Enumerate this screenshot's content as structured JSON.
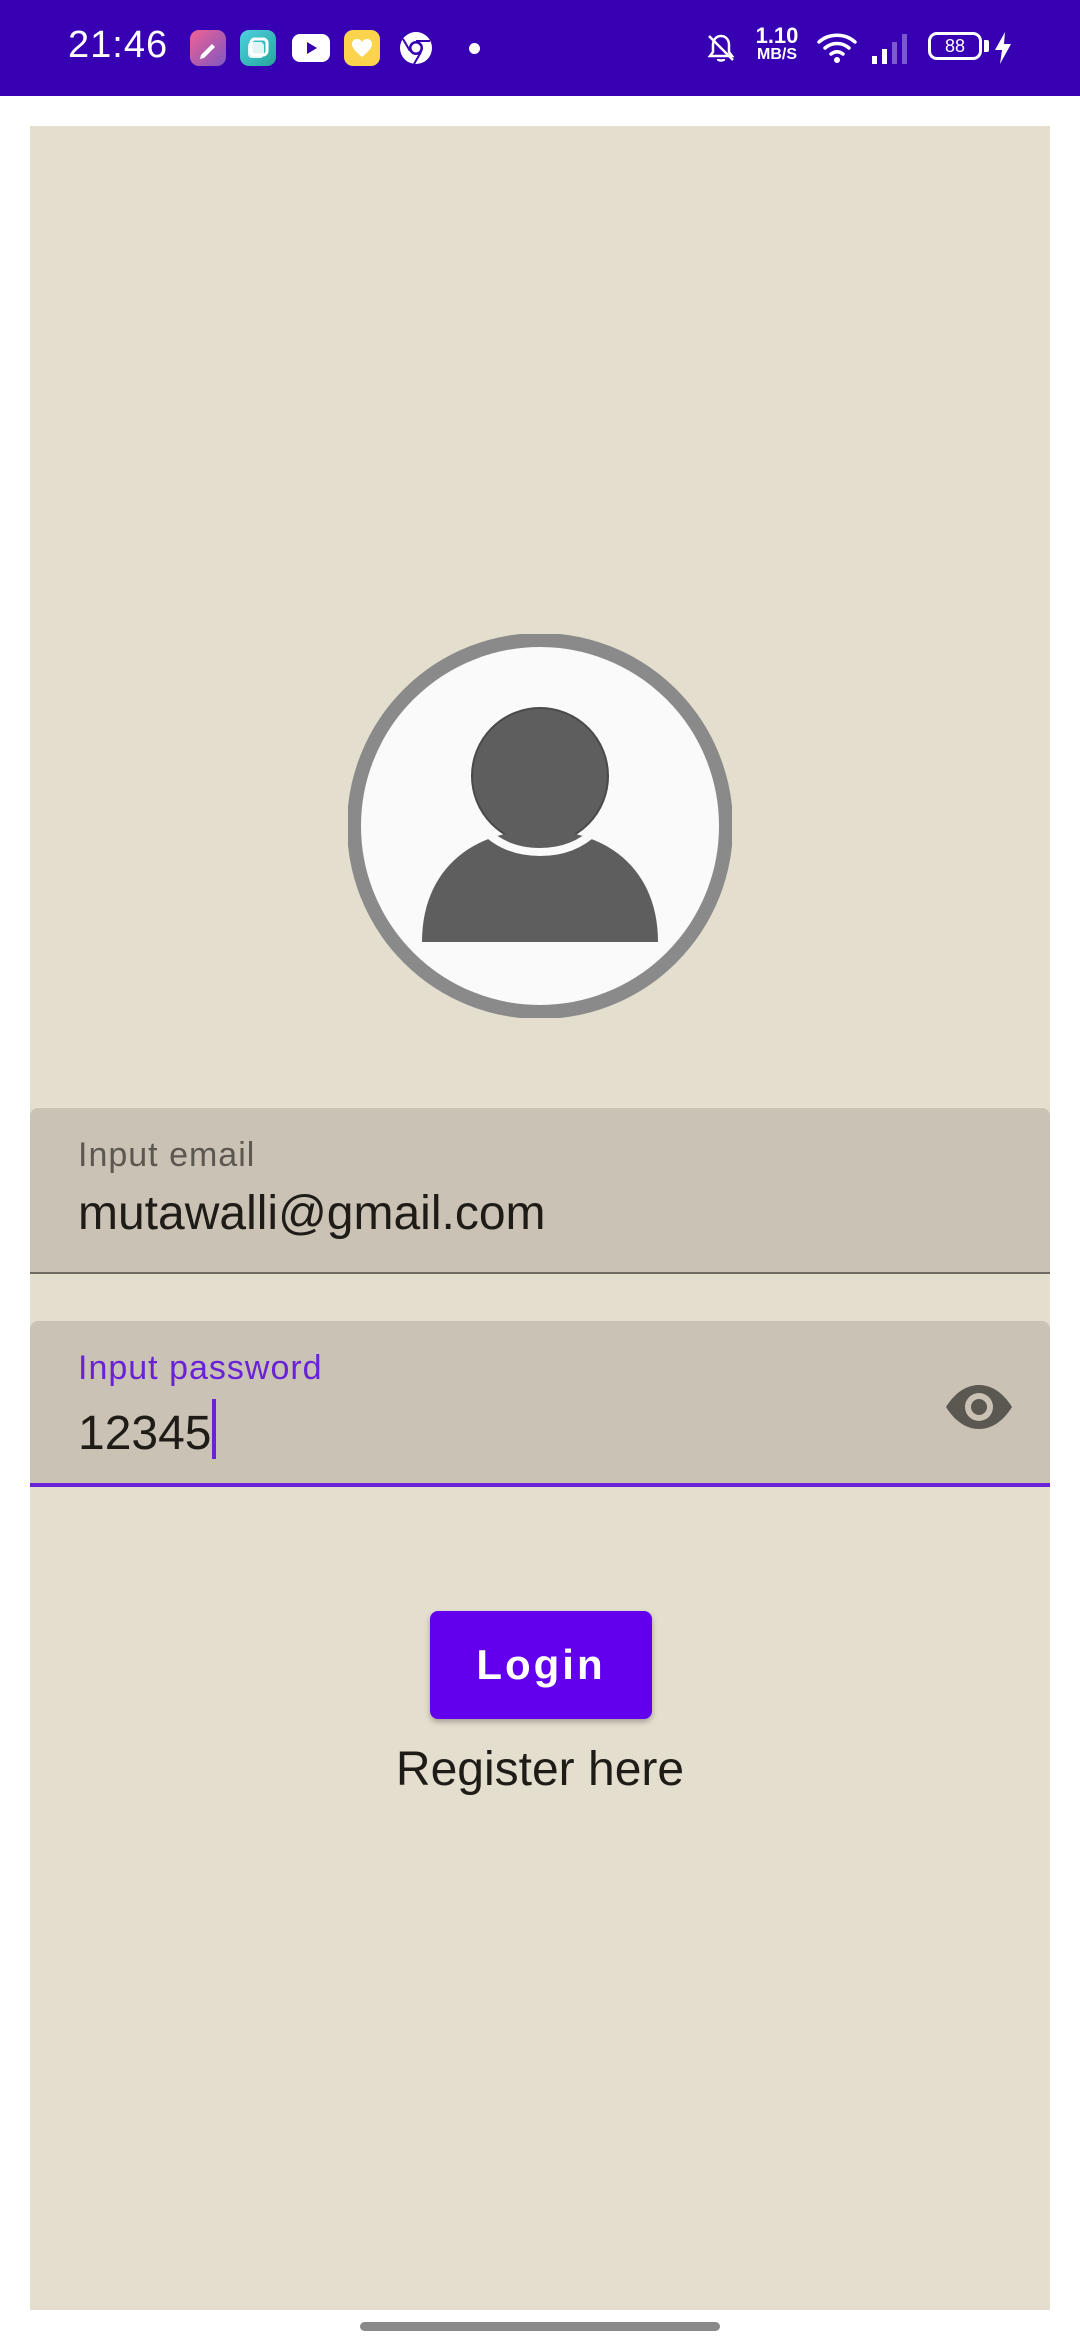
{
  "status_bar": {
    "time": "21:46",
    "net_speed_value": "1.10",
    "net_speed_unit": "MB/S",
    "battery": "88",
    "notification_icons": [
      "editor-app-icon",
      "gallery-app-icon",
      "youtube-icon",
      "wallet-app-icon",
      "chrome-icon"
    ],
    "system_icons": [
      "bell-off-icon",
      "wifi-icon",
      "signal-icon",
      "battery-icon",
      "charging-bolt-icon"
    ]
  },
  "login": {
    "email_label": "Input email",
    "email_value": "mutawalli@gmail.com",
    "password_label": "Input password",
    "password_value": "12345",
    "login_button": "Login",
    "register_link": "Register here"
  },
  "colors": {
    "status_bar": "#3700b3",
    "panel_background": "#e4dece",
    "field_background": "#cac3b5",
    "accent": "#6200ee",
    "focus": "#6a22d6"
  }
}
